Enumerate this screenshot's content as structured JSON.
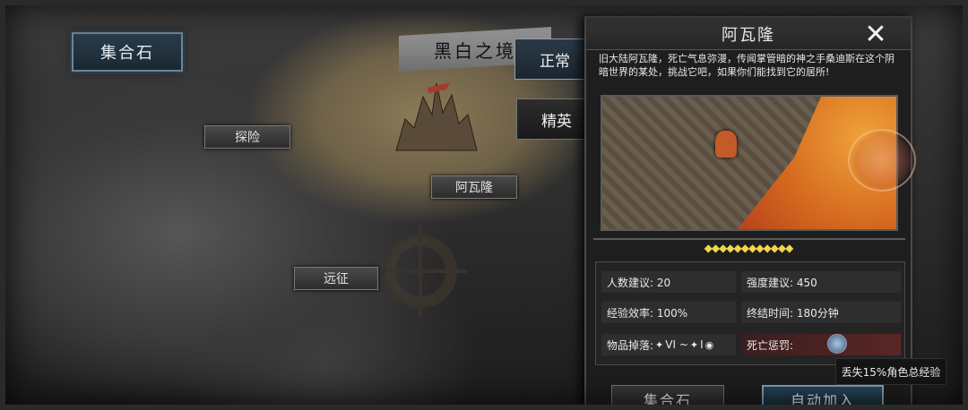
{
  "map": {
    "gather_stone_label": "集合石",
    "region_banner": "黑白之境",
    "tabs": {
      "normal": "正常",
      "elite": "精英"
    },
    "map_buttons": {
      "explore": "探险",
      "expedition": "远征",
      "avalon": "阿瓦隆"
    }
  },
  "panel": {
    "title": "阿瓦隆",
    "description": "旧大陆阿瓦隆，死亡气息弥漫，传闻掌管暗的神之手桑迪斯在这个阴暗世界的某处，挑战它吧，如果你们能找到它的居所!",
    "difficulty_stars": "◆◆◆◆◆◆◆◆◆◆◆◆",
    "info": {
      "players_label": "人数建议: 20",
      "strength_label": "强度建议: 450",
      "exp_label": "经验效率: 100%",
      "end_time_label": "终结时间: 180分钟",
      "drops_label": "物品掉落:",
      "drop_range": "VI ~ ",
      "drop_min": "I",
      "death_penalty_label": "死亡惩罚:"
    },
    "tooltip": "丢失15%角色总经验",
    "buttons": {
      "gather_stone": "集合石",
      "auto_join": "自动加入"
    },
    "close_symbol": "✕"
  },
  "colors": {
    "accent_blue": "#8aa4b8",
    "gold_diamond": "#f1d64b",
    "lava": "#d56a1f"
  }
}
